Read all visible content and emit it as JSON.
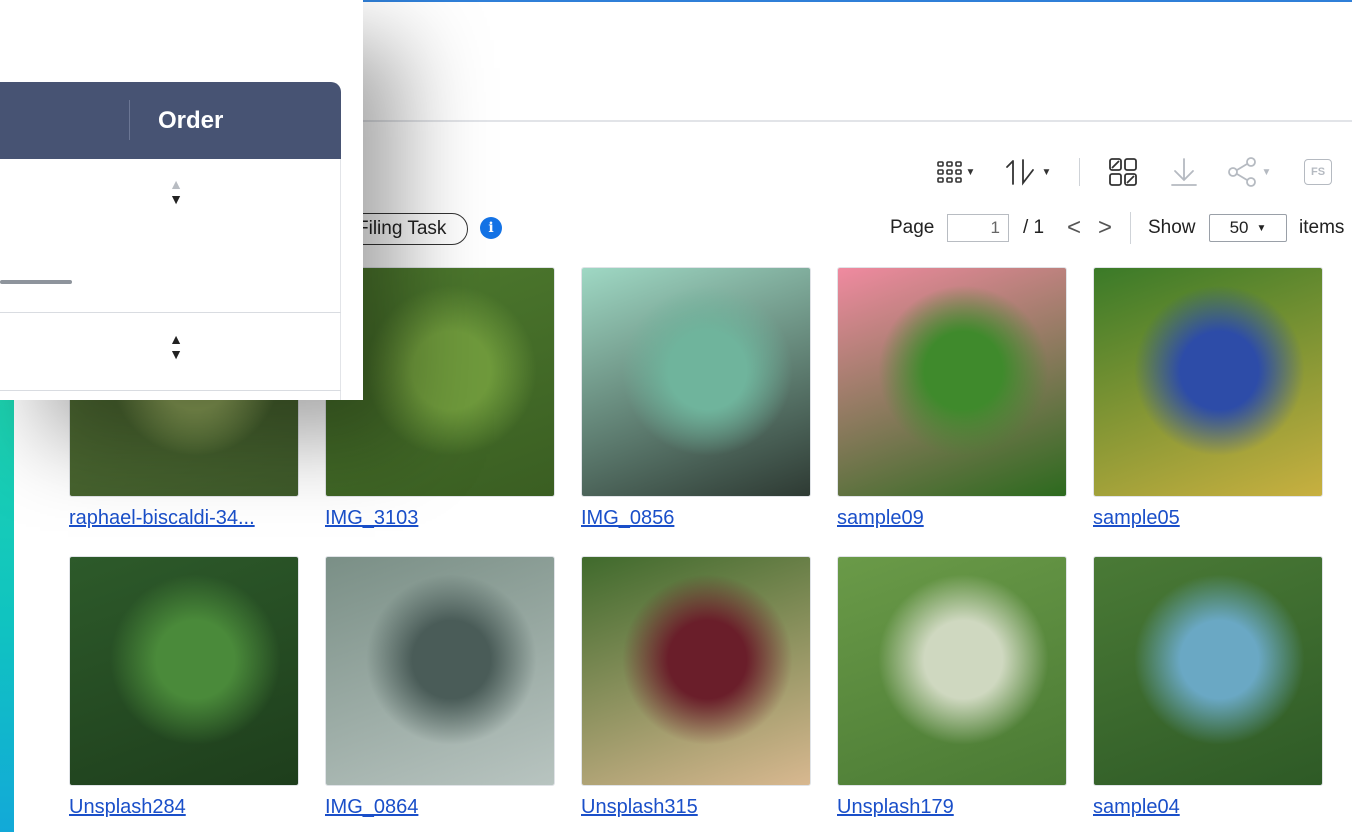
{
  "toolbar": {
    "view_mode_icon": "grid-view-icon",
    "sort_icon": "sort-icon",
    "select_all_icon": "select-all-icon",
    "download_icon": "download-icon",
    "share_icon": "share-icon",
    "fs_icon_label": "FS"
  },
  "filing": {
    "chip_label": "Filing Task",
    "info_icon": "i"
  },
  "pager": {
    "page_label": "Page",
    "page_value": "1",
    "total_pages": "/ 1",
    "prev_symbol": "<",
    "next_symbol": ">",
    "show_label": "Show",
    "show_value": "50",
    "items_label": "items"
  },
  "panel": {
    "column_header": "Order"
  },
  "photos": [
    {
      "name": "raphael-biscaldi-34...",
      "colors": [
        "#5d7a3a",
        "#8fa65a",
        "#3e5a2a"
      ]
    },
    {
      "name": "IMG_3103",
      "colors": [
        "#4e7a2e",
        "#6f9a3c",
        "#3a5e22"
      ]
    },
    {
      "name": "IMG_0856",
      "colors": [
        "#9fd8c4",
        "#6fb49c",
        "#2e3a33"
      ]
    },
    {
      "name": "sample09",
      "colors": [
        "#f08aa0",
        "#3f8a2c",
        "#2c6a1e"
      ]
    },
    {
      "name": "sample05",
      "colors": [
        "#3a7a28",
        "#2d4ca8",
        "#c8b040"
      ]
    },
    {
      "name": "Unsplash284",
      "colors": [
        "#2d5a2a",
        "#4a8a3a",
        "#1e3e1c"
      ]
    },
    {
      "name": "IMG_0864",
      "colors": [
        "#7a8f86",
        "#4a5c58",
        "#b8c4c0"
      ]
    },
    {
      "name": "Unsplash315",
      "colors": [
        "#3f6a2c",
        "#6a1e2a",
        "#d8b890"
      ]
    },
    {
      "name": "Unsplash179",
      "colors": [
        "#6a9a48",
        "#cfd8c0",
        "#4a7a34"
      ]
    },
    {
      "name": "sample04",
      "colors": [
        "#4a7a36",
        "#6aa8c4",
        "#2e5a26"
      ]
    }
  ]
}
